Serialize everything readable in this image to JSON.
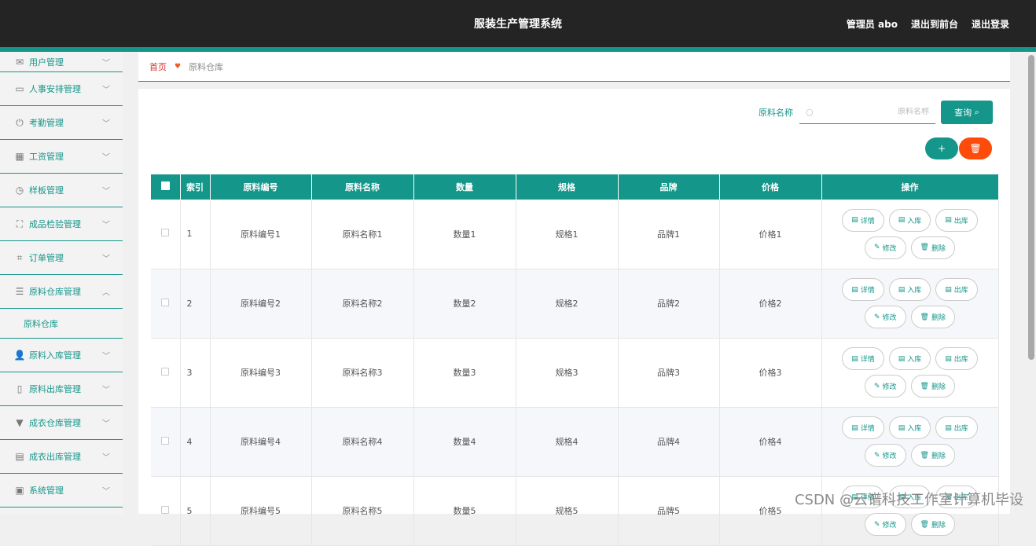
{
  "header": {
    "title": "服装生产管理系统",
    "admin": "管理员 abo",
    "back_front": "退出到前台",
    "logout": "退出登录"
  },
  "sidebar": {
    "items": [
      {
        "label": "用户管理",
        "icon": "mail-icon"
      },
      {
        "label": "人事安排管理",
        "icon": "id-card-icon"
      },
      {
        "label": "考勤管理",
        "icon": "power-icon"
      },
      {
        "label": "工资管理",
        "icon": "grid-icon"
      },
      {
        "label": "样板管理",
        "icon": "clock-icon"
      },
      {
        "label": "成品检验管理",
        "icon": "crop-corners-icon"
      },
      {
        "label": "订单管理",
        "icon": "crop-icon"
      },
      {
        "label": "原料仓库管理",
        "icon": "list-icon"
      },
      {
        "label": "原料入库管理",
        "icon": "user-icon"
      },
      {
        "label": "原料出库管理",
        "icon": "device-icon"
      },
      {
        "label": "成衣仓库管理",
        "icon": "brush-icon"
      },
      {
        "label": "成衣出库管理",
        "icon": "clipboard-icon"
      },
      {
        "label": "系统管理",
        "icon": "camera-icon"
      }
    ],
    "sub_item": "原料仓库"
  },
  "breadcrumb": {
    "home": "首页",
    "current": "原料仓库"
  },
  "search": {
    "label": "原料名称",
    "placeholder": "原料名称",
    "button": "查询"
  },
  "table": {
    "headers": [
      "索引",
      "原料编号",
      "原料名称",
      "数量",
      "规格",
      "品牌",
      "价格",
      "操作"
    ],
    "rows": [
      {
        "index": "1",
        "code": "原料编号1",
        "name": "原料名称1",
        "qty": "数量1",
        "spec": "规格1",
        "brand": "品牌1",
        "price": "价格1"
      },
      {
        "index": "2",
        "code": "原料编号2",
        "name": "原料名称2",
        "qty": "数量2",
        "spec": "规格2",
        "brand": "品牌2",
        "price": "价格2"
      },
      {
        "index": "3",
        "code": "原料编号3",
        "name": "原料名称3",
        "qty": "数量3",
        "spec": "规格3",
        "brand": "品牌3",
        "price": "价格3"
      },
      {
        "index": "4",
        "code": "原料编号4",
        "name": "原料名称4",
        "qty": "数量4",
        "spec": "规格4",
        "brand": "品牌4",
        "price": "价格4"
      },
      {
        "index": "5",
        "code": "原料编号5",
        "name": "原料名称5",
        "qty": "数量5",
        "spec": "规格5",
        "brand": "品牌5",
        "price": "价格5"
      }
    ],
    "actions": {
      "detail": "详情",
      "in": "入库",
      "out": "出库",
      "edit": "修改",
      "delete": "删除"
    }
  },
  "watermark": "CSDN @云谱科技工作室计算机毕设",
  "colors": {
    "accent": "#14968a",
    "danger": "#ff4b0a",
    "header_bg": "#242424"
  }
}
